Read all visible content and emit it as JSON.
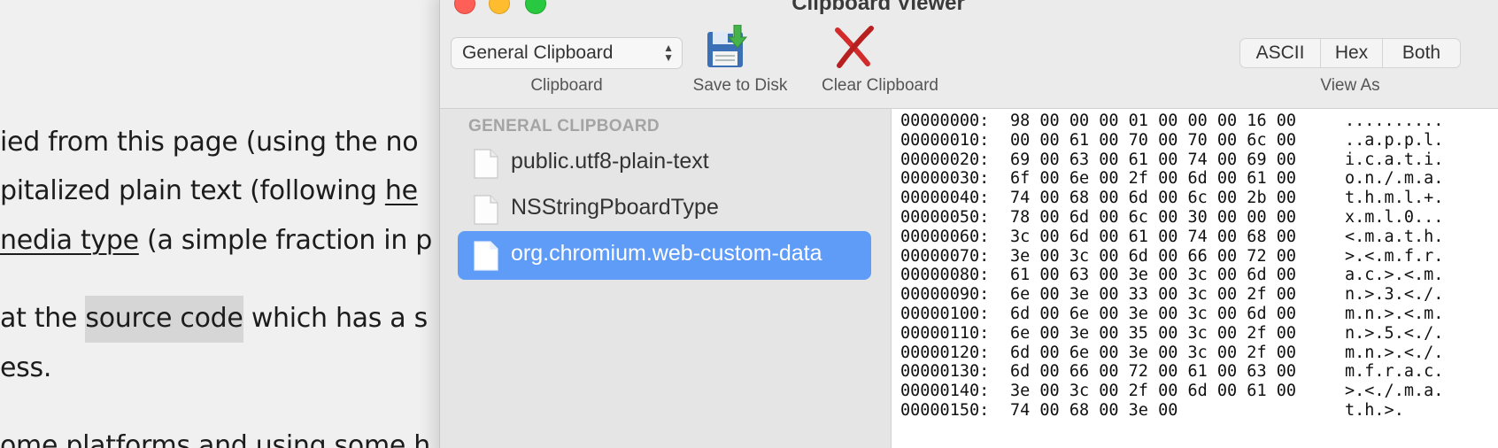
{
  "background_page": {
    "lines": [
      "ied from this page (using the no",
      "pitalized plain text (following ",
      "(a simple fraction in p",
      "at the ",
      " which has a s",
      "ess.",
      "ome platforms and using some h"
    ],
    "link_he": "he",
    "link_media_type": "nedia type",
    "highlight": "source code"
  },
  "window": {
    "title": "Clipboard Viewer",
    "clipboard_popup": {
      "value": "General Clipboard",
      "label": "Clipboard"
    },
    "save_to_disk_label": "Save to Disk",
    "clear_clipboard_label": "Clear Clipboard",
    "view_as": {
      "label": "View As",
      "options": [
        "ASCII",
        "Hex",
        "Both"
      ]
    }
  },
  "sidebar": {
    "header": "GENERAL CLIPBOARD",
    "items": [
      {
        "label": "public.utf8-plain-text",
        "selected": false
      },
      {
        "label": "NSStringPboardType",
        "selected": false
      },
      {
        "label": "org.chromium.web-custom-data",
        "selected": true
      }
    ],
    "selection_color": "#5f9cf7"
  },
  "hex_dump": [
    {
      "offset": "00000000:",
      "hex": "98 00 00 00 01 00 00 00 16 00",
      "ascii": ".........."
    },
    {
      "offset": "00000010:",
      "hex": "00 00 61 00 70 00 70 00 6c 00",
      "ascii": "..a.p.p.l."
    },
    {
      "offset": "00000020:",
      "hex": "69 00 63 00 61 00 74 00 69 00",
      "ascii": "i.c.a.t.i."
    },
    {
      "offset": "00000030:",
      "hex": "6f 00 6e 00 2f 00 6d 00 61 00",
      "ascii": "o.n./.m.a."
    },
    {
      "offset": "00000040:",
      "hex": "74 00 68 00 6d 00 6c 00 2b 00",
      "ascii": "t.h.m.l.+."
    },
    {
      "offset": "00000050:",
      "hex": "78 00 6d 00 6c 00 30 00 00 00",
      "ascii": "x.m.l.0..."
    },
    {
      "offset": "00000060:",
      "hex": "3c 00 6d 00 61 00 74 00 68 00",
      "ascii": "<.m.a.t.h."
    },
    {
      "offset": "00000070:",
      "hex": "3e 00 3c 00 6d 00 66 00 72 00",
      "ascii": ">.<.m.f.r."
    },
    {
      "offset": "00000080:",
      "hex": "61 00 63 00 3e 00 3c 00 6d 00",
      "ascii": "a.c.>.<.m."
    },
    {
      "offset": "00000090:",
      "hex": "6e 00 3e 00 33 00 3c 00 2f 00",
      "ascii": "n.>.3.<./."
    },
    {
      "offset": "00000100:",
      "hex": "6d 00 6e 00 3e 00 3c 00 6d 00",
      "ascii": "m.n.>.<.m."
    },
    {
      "offset": "00000110:",
      "hex": "6e 00 3e 00 35 00 3c 00 2f 00",
      "ascii": "n.>.5.<./."
    },
    {
      "offset": "00000120:",
      "hex": "6d 00 6e 00 3e 00 3c 00 2f 00",
      "ascii": "m.n.>.<./."
    },
    {
      "offset": "00000130:",
      "hex": "6d 00 66 00 72 00 61 00 63 00",
      "ascii": "m.f.r.a.c."
    },
    {
      "offset": "00000140:",
      "hex": "3e 00 3c 00 2f 00 6d 00 61 00",
      "ascii": ">.<./.m.a."
    },
    {
      "offset": "00000150:",
      "hex": "74 00 68 00 3e 00",
      "ascii": "t.h.>."
    }
  ],
  "icons": {
    "save": "floppy-disk-icon",
    "clear": "red-x-icon",
    "document": "document-icon",
    "popup": "up-down-chevron-icon"
  }
}
